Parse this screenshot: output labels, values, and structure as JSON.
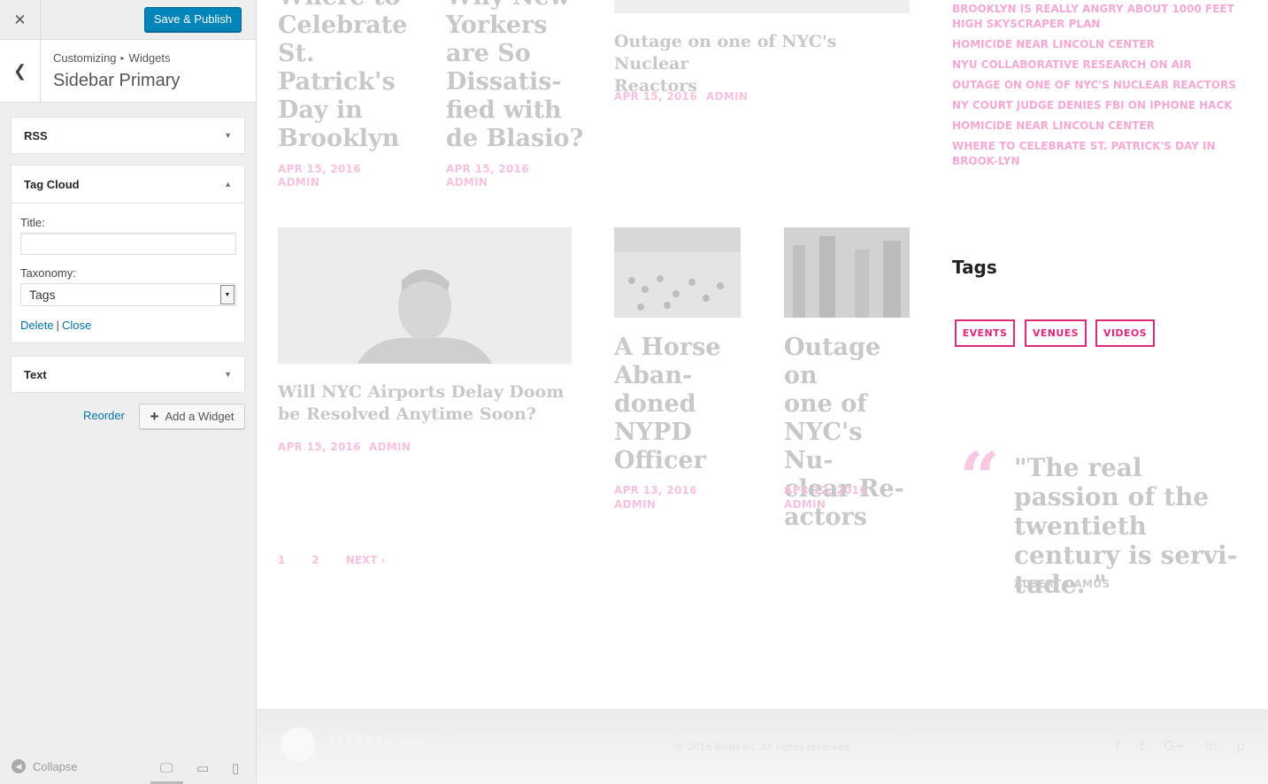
{
  "customizer": {
    "close_icon": "close-icon",
    "save_label": "Save & Publish",
    "breadcrumb": {
      "root": "Customizing",
      "current": "Widgets"
    },
    "section_title": "Sidebar Primary",
    "widgets": {
      "rss": {
        "title": "RSS"
      },
      "tag_cloud": {
        "title": "Tag Cloud",
        "title_label": "Title:",
        "title_value": "",
        "taxonomy_label": "Taxonomy:",
        "taxonomy_value": "Tags",
        "delete_label": "Delete",
        "close_label": "Close"
      },
      "text": {
        "title": "Text"
      }
    },
    "reorder_label": "Reorder",
    "add_widget_label": "Add a Widget",
    "collapse_label": "Collapse",
    "colors": {
      "primary": "#0085ba",
      "link": "#0073aa",
      "panel_bg": "#eeeeee"
    }
  },
  "preview": {
    "top_posts": [
      {
        "title": "Where to Celebrate St. Patrick's Day in Brooklyn",
        "date": "APR 15, 2016",
        "author": "ADMIN"
      },
      {
        "title": "Why New Yorkers are So Dissatis-fied with de Blasio?",
        "date": "APR 15, 2016",
        "author": "ADMIN"
      },
      {
        "title": "Outage on one of NYC's Nuclear Reactors",
        "date": "APR 15, 2016",
        "author": "ADMIN"
      }
    ],
    "top_post_lines": {
      "p1": [
        "Where to",
        "Celebrate",
        "St.",
        "Patrick's",
        "Day in",
        "Brooklyn"
      ],
      "p2": [
        "Why New",
        "Yorkers",
        "are So",
        "Dissatis-",
        "fied with",
        "de Blasio?"
      ],
      "p3": [
        "Outage on one of NYC's Nuclear",
        "Reactors"
      ]
    },
    "recent_posts": [
      "Brooklyn is Really Angry About 1000 Feet High Skyscraper Plan",
      "Homicide Near Lincoln Center",
      "NYU Collaborative Research on Air",
      "Outage on one of NYC's Nuclear Reactors",
      "NY Court Judge Denies FBI on iPhone Hack",
      "Homicide Near Lincoln Center",
      "Where to Celebrate St. Patrick's Day in Brook-lyn"
    ],
    "bottom_posts": {
      "big": {
        "title_lines": [
          "Will NYC Airports Delay Doom",
          "be Resolved Anytime Soon?"
        ],
        "date": "APR 15, 2016",
        "author": "ADMIN"
      },
      "small1": {
        "title_lines": [
          "A Horse",
          "Aban-",
          "doned",
          "NYPD",
          "Officer"
        ],
        "date": "APR 13, 2016",
        "author": "ADMIN"
      },
      "small2": {
        "title_lines": [
          "Outage on",
          "one of",
          "NYC's Nu-",
          "clear Re-",
          "actors"
        ],
        "date": "APR 12, 2016",
        "author": "ADMIN"
      }
    },
    "tags": {
      "title": "Tags",
      "items": [
        "EVENTS",
        "VENUES",
        "VIDEOS"
      ]
    },
    "quote": {
      "text": "\"The real passion of the twentieth century is servi-tude. \"",
      "author": "ALBERT CAMUS"
    },
    "pagination": {
      "p1": "1",
      "p2": "2",
      "next": "NEXT"
    },
    "footer": {
      "logo_text": "BitNews",
      "copyright": "© 2016 BitNews. All rights reserved.",
      "social_icons": [
        "facebook-icon",
        "twitter-icon",
        "google-plus-icon",
        "linkedin-icon",
        "pinterest-icon"
      ]
    },
    "colors": {
      "accent": "#e0287d",
      "muted_accent": "#f6c2df",
      "title_gray": "#c8c8c8"
    }
  }
}
